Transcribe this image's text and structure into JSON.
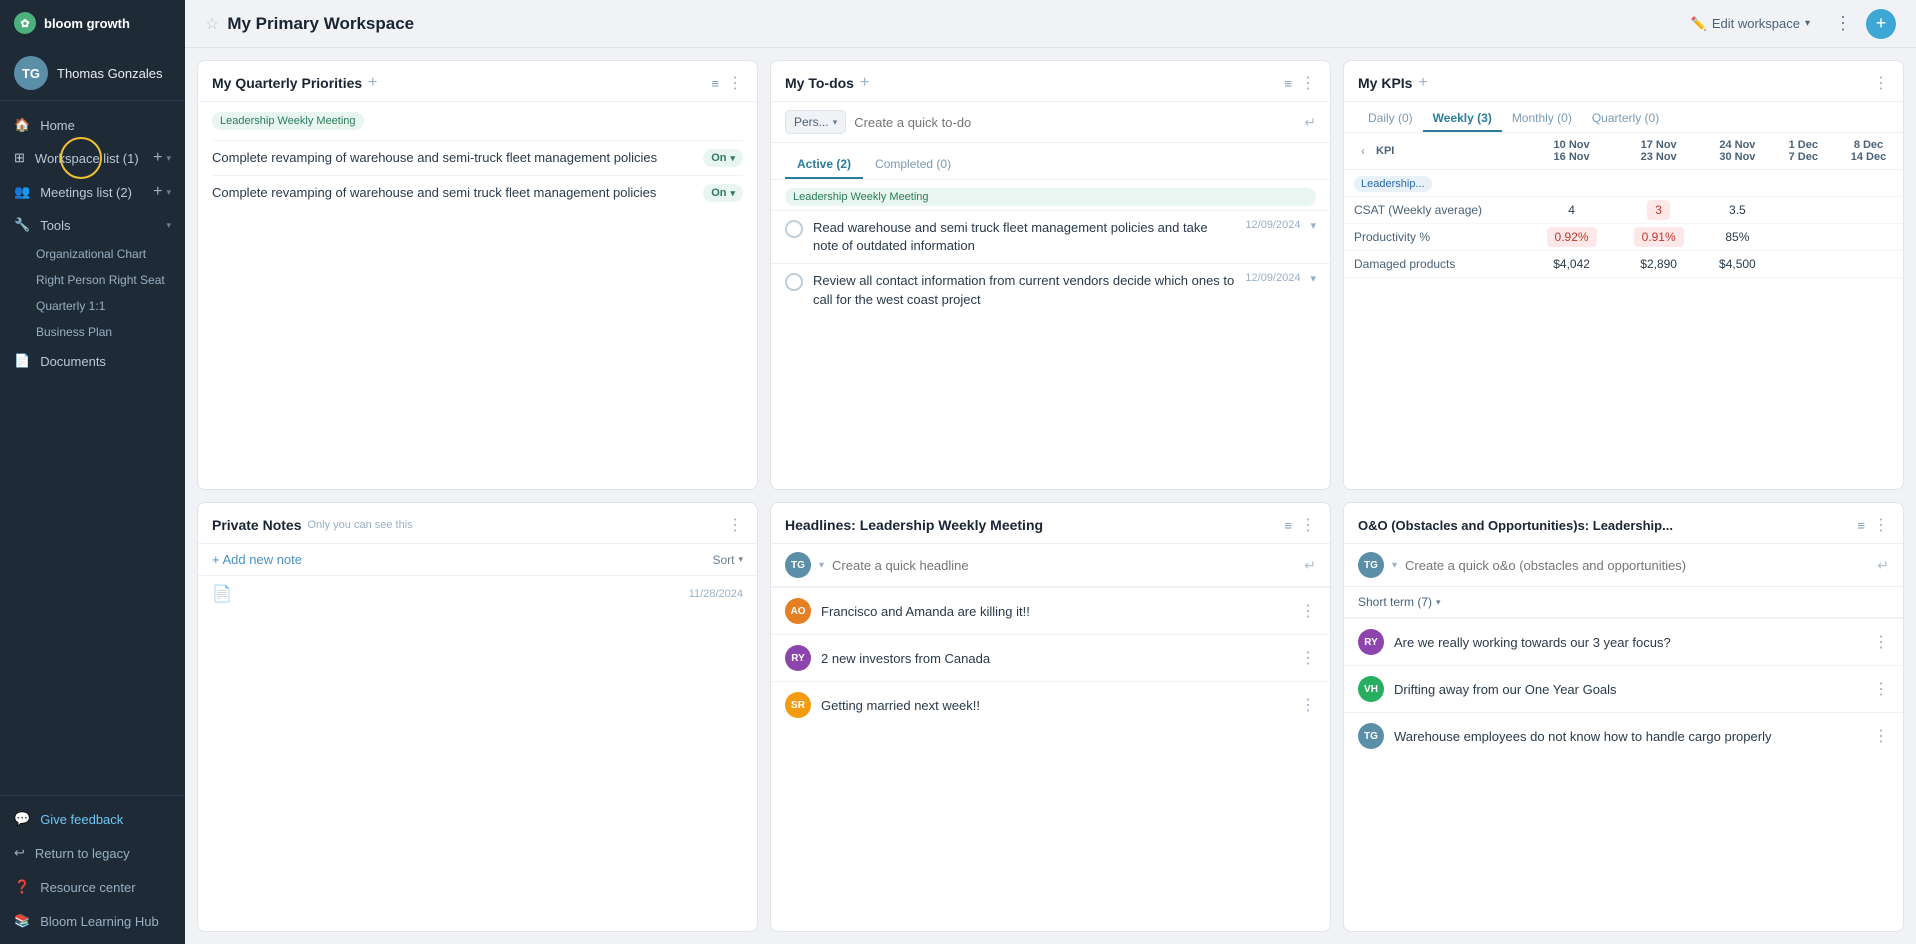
{
  "app": {
    "logo_text": "bloom growth",
    "logo_abbr": "bg"
  },
  "sidebar": {
    "user_name": "Thomas Gonzales",
    "user_initials": "TG",
    "nav_items": [
      {
        "label": "Home",
        "icon": "home"
      },
      {
        "label": "Workspace list (1)",
        "icon": "grid",
        "has_add": true
      },
      {
        "label": "Meetings list (2)",
        "icon": "people",
        "has_add": true
      }
    ],
    "tools_label": "Tools",
    "tools_items": [
      {
        "label": "Organizational Chart"
      },
      {
        "label": "Right Person Right Seat"
      },
      {
        "label": "Quarterly 1:1"
      },
      {
        "label": "Business Plan"
      }
    ],
    "documents_label": "Documents",
    "bottom_items": [
      {
        "label": "Give feedback",
        "icon": "comment"
      },
      {
        "label": "Return to legacy",
        "icon": "undo"
      },
      {
        "label": "Resource center",
        "icon": "question"
      },
      {
        "label": "Bloom Learning Hub",
        "icon": "book"
      }
    ]
  },
  "topbar": {
    "title": "My Primary Workspace",
    "edit_label": "Edit workspace",
    "star": "☆"
  },
  "priorities_card": {
    "title": "My Quarterly Priorities",
    "meeting_tag": "Leadership Weekly Meeting",
    "items": [
      {
        "text": "Complete revamping of warehouse and semi-truck fleet management policies",
        "status": "On"
      },
      {
        "text": "Complete revamping of warehouse and semi truck fleet management policies",
        "status": "On"
      }
    ]
  },
  "todos_card": {
    "title": "My To-dos",
    "filter_label": "Pers...",
    "quick_add_placeholder": "Create a quick to-do",
    "tabs": [
      {
        "label": "Active (2)",
        "active": true
      },
      {
        "label": "Completed (0)",
        "active": false
      }
    ],
    "meeting_tag": "Leadership Weekly Meeting",
    "items": [
      {
        "text": "Read warehouse and semi truck fleet management policies and take note of outdated information",
        "date": "12/09/2024"
      },
      {
        "text": "Review all contact information from current vendors decide which ones to call for the west coast project",
        "date": "12/09/2024"
      }
    ]
  },
  "kpis_card": {
    "title": "My KPIs",
    "tabs": [
      {
        "label": "Daily (0)",
        "active": false
      },
      {
        "label": "Weekly (3)",
        "active": true
      },
      {
        "label": "Monthly (0)",
        "active": false
      },
      {
        "label": "Quarterly (0)",
        "active": false
      }
    ],
    "col_headers": [
      {
        "line1": "10 Nov",
        "line2": "16 Nov"
      },
      {
        "line1": "17 Nov",
        "line2": "23 Nov"
      },
      {
        "line1": "24 Nov",
        "line2": "30 Nov"
      },
      {
        "line1": "1 Dec",
        "line2": "7 Dec"
      },
      {
        "line1": "8 Dec",
        "line2": "14 Dec"
      }
    ],
    "kpi_col_label": "KPI",
    "rows": [
      {
        "name": "Leadership...",
        "values": [
          "",
          "",
          "",
          "",
          ""
        ]
      },
      {
        "name": "CSAT (Weekly average)",
        "values": [
          "4",
          "3",
          "3.5",
          "",
          ""
        ]
      },
      {
        "name": "Productivity %",
        "values": [
          "0.92%",
          "0.91%",
          "85%",
          "",
          ""
        ]
      },
      {
        "name": "Damaged products",
        "values": [
          "$4,042",
          "$2,890",
          "$4,500",
          "",
          ""
        ]
      }
    ]
  },
  "notes_card": {
    "title": "Private Notes",
    "subtitle": "Only you can see this",
    "add_note_label": "+ Add new note",
    "sort_label": "Sort",
    "note_date": "11/28/2024"
  },
  "headlines_card": {
    "title": "Headlines: Leadership Weekly Meeting",
    "quick_add_placeholder": "Create a quick headline",
    "items": [
      {
        "initials": "AO",
        "bg": "#e67e22",
        "text": "Francisco and Amanda are killing it!!"
      },
      {
        "initials": "RY",
        "bg": "#8e44ad",
        "text": "2 new investors from Canada"
      },
      {
        "initials": "SR",
        "bg": "#f39c12",
        "text": "Getting married next week!!"
      }
    ]
  },
  "oo_card": {
    "title": "O&O (Obstacles and Opportunities)s: Leadership...",
    "quick_add_placeholder": "Create a quick o&o (obstacles and opportunities)",
    "filter_label": "Short term (7)",
    "items": [
      {
        "initials": "RY",
        "bg": "#8e44ad",
        "text": "Are we really working towards our 3 year focus?"
      },
      {
        "initials": "VH",
        "bg": "#27ae60",
        "text": "Drifting away from our One Year Goals"
      },
      {
        "initials": "TG",
        "bg": "#5b8fa8",
        "text": "Warehouse employees do not know how to handle cargo properly"
      }
    ]
  }
}
